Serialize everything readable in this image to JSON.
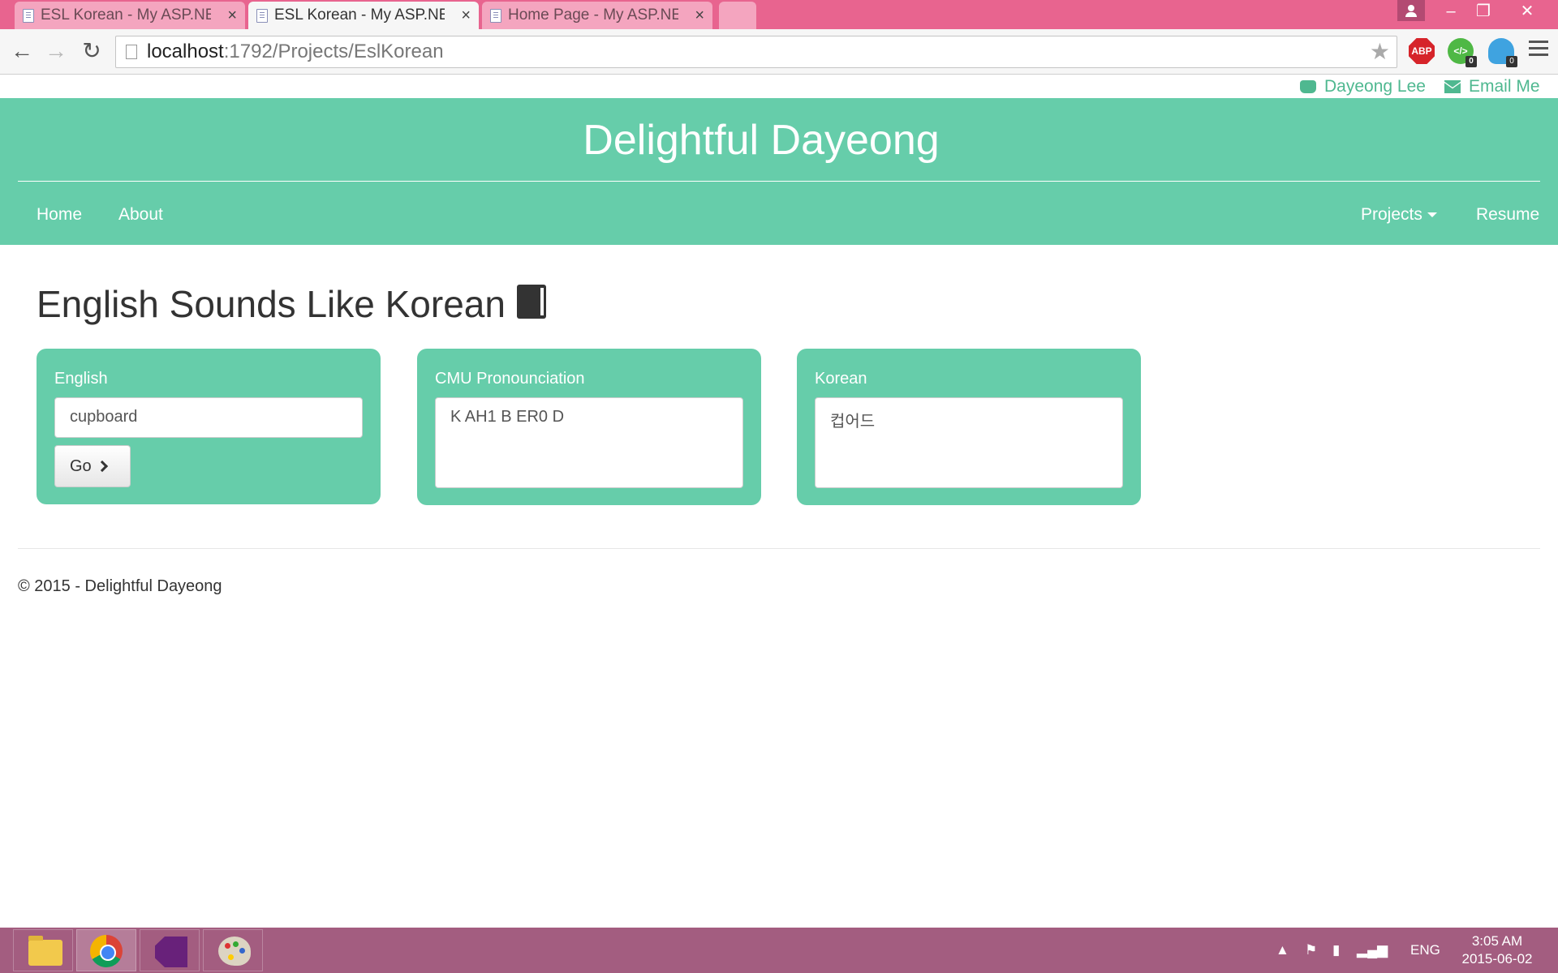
{
  "browser": {
    "tabs": [
      {
        "title": "ESL Korean - My ASP.NET",
        "active": false
      },
      {
        "title": "ESL Korean - My ASP.NET",
        "active": true
      },
      {
        "title": "Home Page - My ASP.NET",
        "active": false
      }
    ],
    "url_host": "localhost",
    "url_path": ":1792/Projects/EslKorean",
    "extensions": {
      "abp_label": "ABP",
      "badge_1": "0",
      "badge_2": "0"
    }
  },
  "site": {
    "top_links": {
      "github": "Dayeong Lee",
      "email": "Email Me"
    },
    "brand": "Delightful Dayeong",
    "nav_left": [
      "Home",
      "About"
    ],
    "nav_right": {
      "projects": "Projects",
      "resume": "Resume"
    }
  },
  "main": {
    "heading": "English Sounds Like Korean",
    "english": {
      "label": "English",
      "value": "cupboard",
      "go_label": "Go"
    },
    "cmu": {
      "label": "CMU Pronounciation",
      "value": "K AH1 B ER0 D"
    },
    "korean": {
      "label": "Korean",
      "value": "컵어드"
    }
  },
  "footer": {
    "text": "© 2015 - Delightful Dayeong"
  },
  "taskbar": {
    "apps": [
      "file-explorer-icon",
      "chrome-icon",
      "visual-studio-icon",
      "paint-icon"
    ],
    "lang": "ENG",
    "time": "3:05 AM",
    "date": "2015-06-02"
  },
  "colors": {
    "accent": "#66cdaa",
    "titlebar": "#e8648f",
    "taskbar": "#a35d80",
    "link": "#4fb890"
  }
}
